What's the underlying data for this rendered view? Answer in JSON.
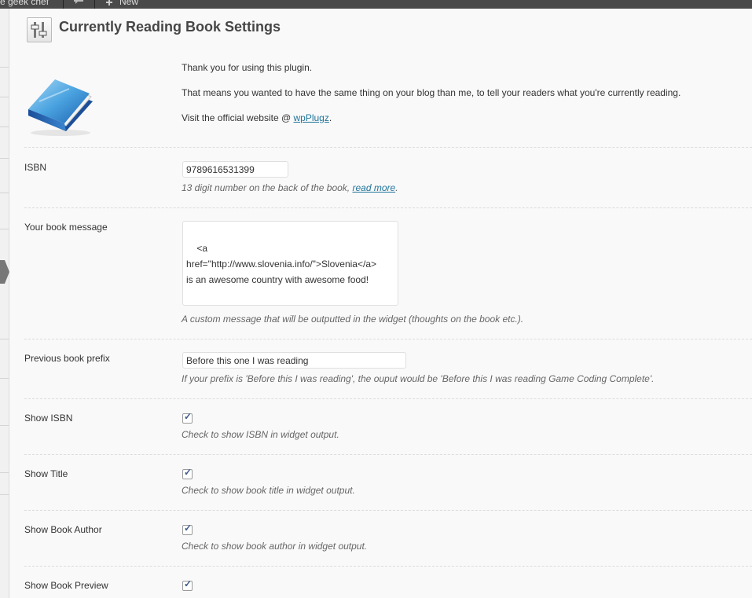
{
  "adminbar": {
    "site_fragment": "e geek chef",
    "new_label": "New"
  },
  "page": {
    "title": "Currently Reading Book Settings"
  },
  "intro": {
    "thanks": "Thank you for using this plugin.",
    "purpose": "That means you wanted to have the same thing on your blog than me, to tell your readers what you're currently reading.",
    "visit_prefix": "Visit the official website @ ",
    "visit_link": "wpPlugz",
    "visit_suffix": "."
  },
  "fields": {
    "isbn": {
      "label": "ISBN",
      "value": "9789616531399",
      "desc_prefix": "13 digit number on the back of the book, ",
      "desc_link": "read more",
      "desc_suffix": "."
    },
    "message": {
      "label": "Your book message",
      "value": "<a href=\"http://www.slovenia.info/\">Slovenia</a>\nis an awesome country with awesome food!",
      "desc": "A custom message that will be outputted in the widget (thoughts on the book etc.)."
    },
    "prefix": {
      "label": "Previous book prefix",
      "value": "Before this one I was reading",
      "desc": "If your prefix is 'Before this I was reading', the ouput would be 'Before this I was reading Game Coding Complete'."
    },
    "show_isbn": {
      "label": "Show ISBN",
      "checked": true,
      "desc": "Check to show ISBN in widget output."
    },
    "show_title": {
      "label": "Show Title",
      "checked": true,
      "desc": "Check to show book title in widget output."
    },
    "show_author": {
      "label": "Show Book Author",
      "checked": true,
      "desc": "Check to show book author in widget output."
    },
    "show_preview": {
      "label": "Show Book Preview",
      "checked": true
    }
  },
  "checkmark": "✓"
}
